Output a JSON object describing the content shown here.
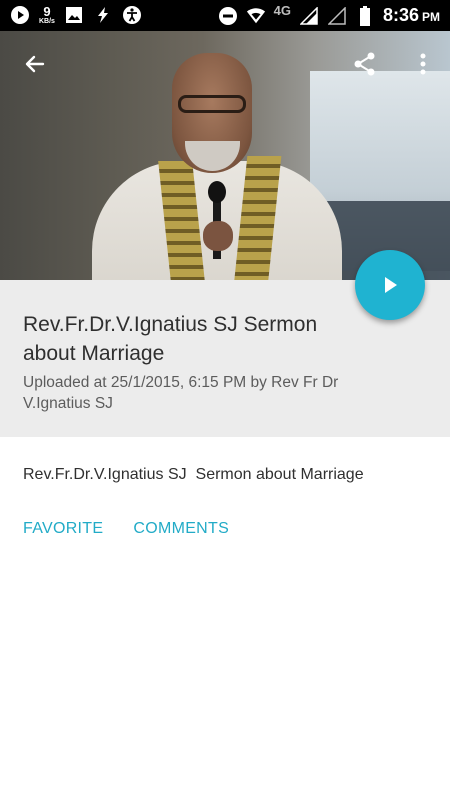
{
  "status_bar": {
    "speed_value": "9",
    "speed_unit": "KB/s",
    "network_type": "4G",
    "time": "8:36",
    "ampm": "PM",
    "icons": [
      "play-icon",
      "image-icon",
      "flash-icon",
      "accessibility-icon",
      "dnd-icon",
      "wifi-icon",
      "signal-icon",
      "signal-empty-icon",
      "battery-icon"
    ]
  },
  "video": {
    "title": "Rev.Fr.Dr.V.Ignatius SJ Sermon about Marriage",
    "uploaded": "Uploaded at 25/1/2015, 6:15 PM by Rev Fr Dr V.Ignatius SJ",
    "description": "Rev.Fr.Dr.V.Ignatius SJ  Sermon about Marriage"
  },
  "actions": {
    "favorite": "FAVORITE",
    "comments": "COMMENTS"
  },
  "colors": {
    "accent": "#1fb3d1",
    "panel_bg": "#ececec"
  }
}
